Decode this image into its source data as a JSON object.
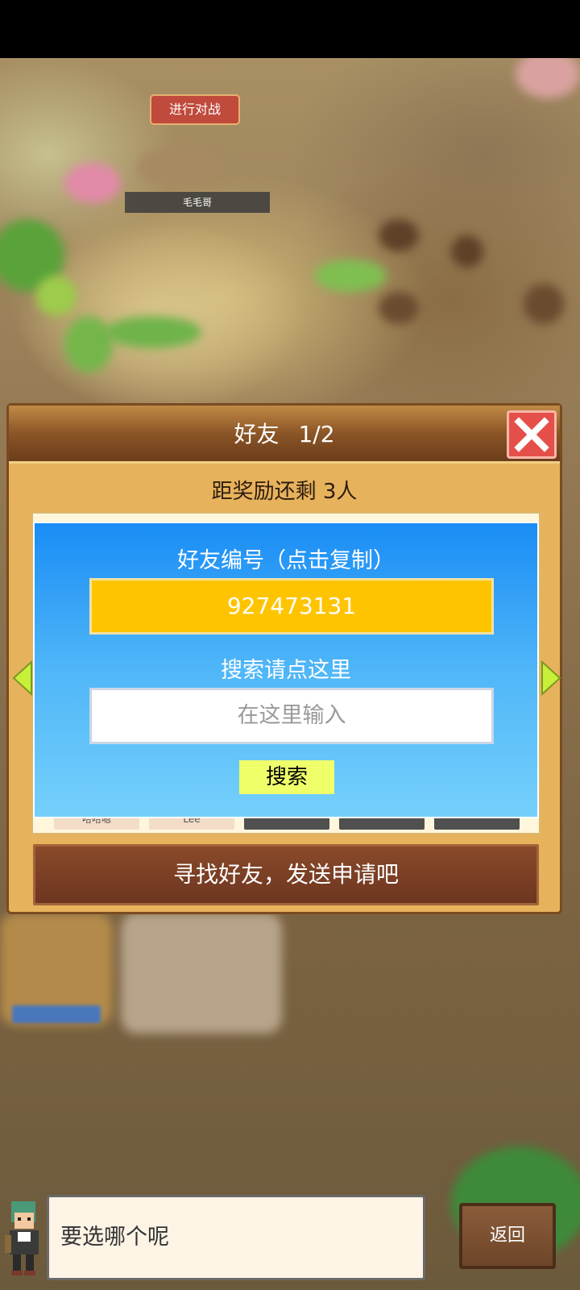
{
  "world": {
    "battle_button": "进行对战",
    "player_name": "毛毛哥"
  },
  "friends_dialog": {
    "title": "好友",
    "page": "1/2",
    "reward_remaining": "距奖励还剩 3人",
    "slot_labels": [
      "哈哈嗯",
      "Lee"
    ],
    "id_label": "好友编号（点击复制）",
    "friend_id": "927473131",
    "search_label": "搜索请点这里",
    "search_placeholder": "在这里输入",
    "search_button": "搜索",
    "find_friends_button": "寻找好友，发送申请吧"
  },
  "footer": {
    "speech_text": "要选哪个呢",
    "back_button": "返回"
  },
  "colors": {
    "dialog_bg": "#e7b25c",
    "id_box": "#ffc400",
    "search_button": "#efff6a",
    "close_button": "#e45049"
  }
}
